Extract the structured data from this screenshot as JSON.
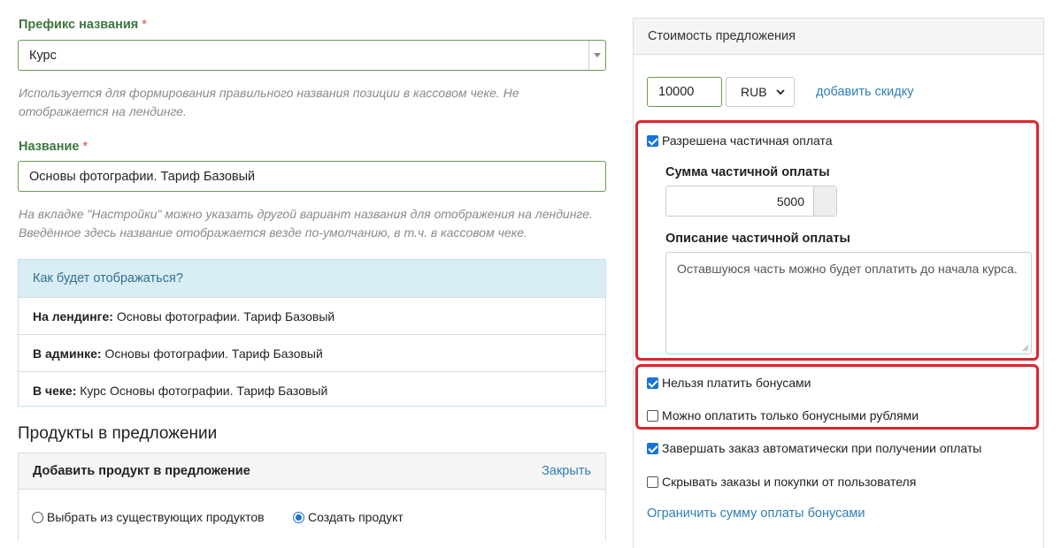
{
  "prefix": {
    "label": "Префикс названия",
    "required_mark": "*",
    "value": "Курс",
    "hint": "Используется для формирования правильного названия позиции в кассовом чеке. Не отображается на лендинге."
  },
  "name": {
    "label": "Название",
    "required_mark": "*",
    "value": "Основы фотографии. Тариф Базовый",
    "hint": "На вкладке \"Настройки\" можно указать другой вариант названия для отображения на лендинге. Введённое здесь название отображается везде по-умолчанию, в т.ч. в кассовом чеке."
  },
  "preview": {
    "title": "Как будет отображаться?",
    "rows": [
      {
        "label": "На лендинге:",
        "value": "Основы фотографии. Тариф Базовый"
      },
      {
        "label": "В админке:",
        "value": "Основы фотографии. Тариф Базовый"
      },
      {
        "label": "В чеке:",
        "value": "Курс Основы фотографии. Тариф Базовый"
      }
    ]
  },
  "products": {
    "heading": "Продукты в предложении",
    "add_title": "Добавить продукт в предложение",
    "close_link": "Закрыть",
    "option_existing": "Выбрать из существующих продуктов",
    "option_create": "Создать продукт"
  },
  "cost": {
    "title": "Стоимость предложения",
    "price": "10000",
    "currency": "RUB",
    "discount_link": "добавить скидку",
    "partial_allowed": "Разрешена частичная оплата",
    "partial_sum_label": "Сумма частичной оплаты",
    "partial_sum_value": "5000",
    "partial_desc_label": "Описание частичной оплаты",
    "partial_desc_value": "Оставшуюся часть можно будет оплатить до начала курса.",
    "no_bonus": "Нельзя платить бонусами",
    "only_bonus": "Можно оплатить только бонусными рублями",
    "auto_complete": "Завершать заказ автоматически при получении оплаты",
    "hide_orders": "Скрывать заказы и покупки от пользователя",
    "limit_bonus_link": "Ограничить сумму оплаты бонусами"
  },
  "colors": {
    "accent_green": "#3c763d",
    "link_blue": "#2e7fb8",
    "highlight_red": "#d9262c",
    "info_bg": "#d9edf7"
  }
}
